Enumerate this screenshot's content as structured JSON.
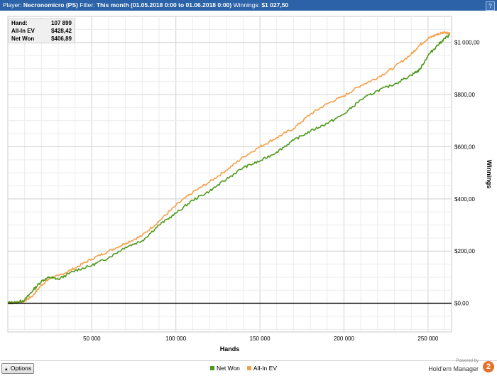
{
  "header": {
    "player_label": "Player:",
    "player_value": "Necronomicro (PS)",
    "filter_label": "Filter:",
    "filter_value": "This month (01.05.2018 0:00 to 01.06.2018 0:00)",
    "winnings_label": "Winnings:",
    "winnings_value": "$1 027,50",
    "help_label": "?"
  },
  "stats": [
    {
      "label": "Hand:",
      "value": "107 899"
    },
    {
      "label": "All-In EV",
      "value": "$428,42"
    },
    {
      "label": "Net Won",
      "value": "$406,89"
    }
  ],
  "options_label": "Options",
  "branding": {
    "powered_by": "Powered by",
    "name": "Hold'em Manager",
    "logo_text": "2"
  },
  "chart_data": {
    "type": "line",
    "xlabel": "Hands",
    "ylabel": "Winnings",
    "xlim": [
      0,
      264000
    ],
    "ylim": [
      -110,
      1100
    ],
    "x_ticks": [
      50000,
      100000,
      150000,
      200000,
      250000
    ],
    "x_tick_labels": [
      "50 000",
      "100 000",
      "150 000",
      "200 000",
      "250 000"
    ],
    "y_ticks": [
      0,
      200,
      400,
      600,
      800,
      1000
    ],
    "y_tick_labels": [
      "$0,00",
      "$200,00",
      "$400,00",
      "$600,00",
      "$800,00",
      "$1 000,00"
    ],
    "grid": true,
    "legend_position": "bottom-center",
    "series": [
      {
        "name": "Net Won",
        "color": "#4e9a1f",
        "x": [
          0,
          5000,
          10000,
          15000,
          20000,
          25000,
          30000,
          40000,
          50000,
          60000,
          70000,
          80000,
          90000,
          100000,
          110000,
          120000,
          130000,
          140000,
          150000,
          160000,
          170000,
          180000,
          190000,
          200000,
          210000,
          220000,
          230000,
          240000,
          245000,
          250000,
          255000,
          260000,
          263000
        ],
        "y": [
          2,
          3,
          12,
          50,
          85,
          100,
          92,
          125,
          145,
          175,
          215,
          240,
          300,
          345,
          395,
          430,
          475,
          520,
          545,
          580,
          625,
          660,
          690,
          725,
          780,
          815,
          840,
          875,
          895,
          950,
          985,
          1015,
          1030
        ]
      },
      {
        "name": "All-In EV",
        "color": "#f5a04a",
        "x": [
          0,
          5000,
          10000,
          15000,
          20000,
          25000,
          30000,
          40000,
          50000,
          60000,
          70000,
          80000,
          90000,
          100000,
          110000,
          120000,
          130000,
          140000,
          150000,
          160000,
          170000,
          180000,
          190000,
          200000,
          210000,
          220000,
          230000,
          240000,
          245000,
          250000,
          255000,
          260000,
          263000
        ],
        "y": [
          1,
          2,
          8,
          30,
          70,
          95,
          105,
          135,
          170,
          200,
          230,
          260,
          315,
          375,
          425,
          465,
          510,
          560,
          600,
          635,
          670,
          725,
          765,
          795,
          835,
          865,
          905,
          955,
          990,
          1015,
          1030,
          1040,
          1035
        ]
      }
    ]
  }
}
